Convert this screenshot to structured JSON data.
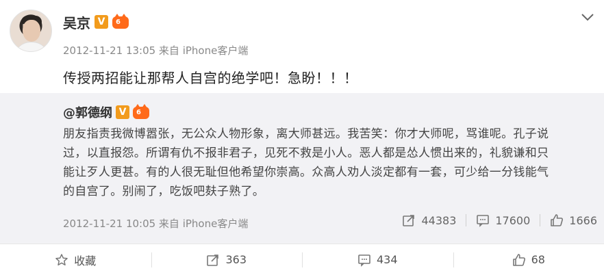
{
  "post": {
    "author": "吴京",
    "vip_level": "6",
    "meta": "2012-11-21 13:05 来自 iPhone客户端",
    "text": "传授两招能让那帮人自宫的绝学吧！急盼！！！"
  },
  "quoted": {
    "author": "@郭德纲",
    "vip_level": "6",
    "lines": [
      "朋友指责我微博嚣张，无公众人物形象，离大师甚远。我苦笑：你才大师呢，骂谁呢。孔子说",
      "过，以直报怨。所谓有仇不报非君子，见死不救是小人。恶人都是怂人惯出来的，礼貌谦和只",
      "能让歹人更甚。有的人很无耻但他希望你崇高。众高人劝人淡定都有一套，可少给一分钱能气",
      "的自宫了。别闹了，吃饭吧麸子熟了。"
    ],
    "meta": "2012-11-21 10:05 来自 iPhone客户端",
    "reposts": "44383",
    "comments": "17600",
    "likes": "1666"
  },
  "actions": {
    "favorite": "收藏",
    "repost": "363",
    "comment": "434",
    "like": "68"
  },
  "colors": {
    "verified": "#f29b1c",
    "vip": "#ff6a1a",
    "quote_bg": "#f2f2f5"
  },
  "icons": [
    "chevron-down-icon",
    "verified-v-icon",
    "vip-crown-icon",
    "repost-icon",
    "comment-icon",
    "like-icon",
    "star-icon"
  ]
}
